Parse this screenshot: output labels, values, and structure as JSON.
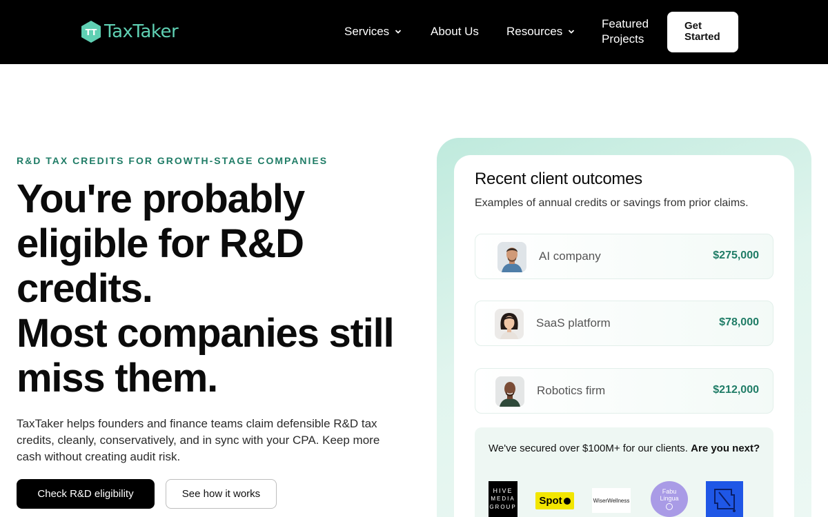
{
  "brand": {
    "name": "TaxTaker",
    "logo_initials": "TT",
    "logo_color": "#5fd0b3"
  },
  "nav": {
    "items": [
      {
        "label": "Services",
        "has_dropdown": true
      },
      {
        "label": "About Us",
        "has_dropdown": false
      },
      {
        "label": "Resources",
        "has_dropdown": true
      },
      {
        "label": "Featured Projects",
        "has_dropdown": false
      }
    ],
    "cta_label": "Get Started"
  },
  "hero": {
    "eyebrow": "R&D TAX CREDITS FOR GROWTH-STAGE COMPANIES",
    "headline_line1": "You're probably eligible for R&D credits.",
    "headline_line2": "Most companies still miss them.",
    "lead": "TaxTaker helps founders and finance teams claim defensible R&D tax credits, cleanly, conservatively, and in sync with your CPA. Keep more cash without creating audit risk.",
    "primary_button": "Check R&D eligibility",
    "secondary_button": "See how it works"
  },
  "outcomes": {
    "title": "Recent client outcomes",
    "subtitle": "Examples of annual credits or savings from prior claims.",
    "items": [
      {
        "label": "AI company",
        "amount": "$275,000",
        "avatar": "man-avatar"
      },
      {
        "label": "SaaS platform",
        "amount": "$78,000",
        "avatar": "woman-avatar"
      },
      {
        "label": "Robotics firm",
        "amount": "$212,000",
        "avatar": "man-avatar-2"
      }
    ],
    "secured_text": "We've secured over $100M+ for our clients.",
    "secured_bold": "Are you next?",
    "client_logos": [
      {
        "name": "hive-media-group-logo",
        "lines": [
          "HIVE",
          "MEDIA",
          "GROUP"
        ]
      },
      {
        "name": "spot-logo",
        "text": "Spot"
      },
      {
        "name": "wiser-wellness-logo",
        "text": "WiserWellness"
      },
      {
        "name": "fabu-lingua-logo",
        "text": "Fabu Lingua"
      },
      {
        "name": "blue-square-logo",
        "text": "N"
      }
    ]
  },
  "colors": {
    "accent": "#1f7c66",
    "nav_bg": "#000000",
    "panel_tint": "#bfeadd"
  }
}
